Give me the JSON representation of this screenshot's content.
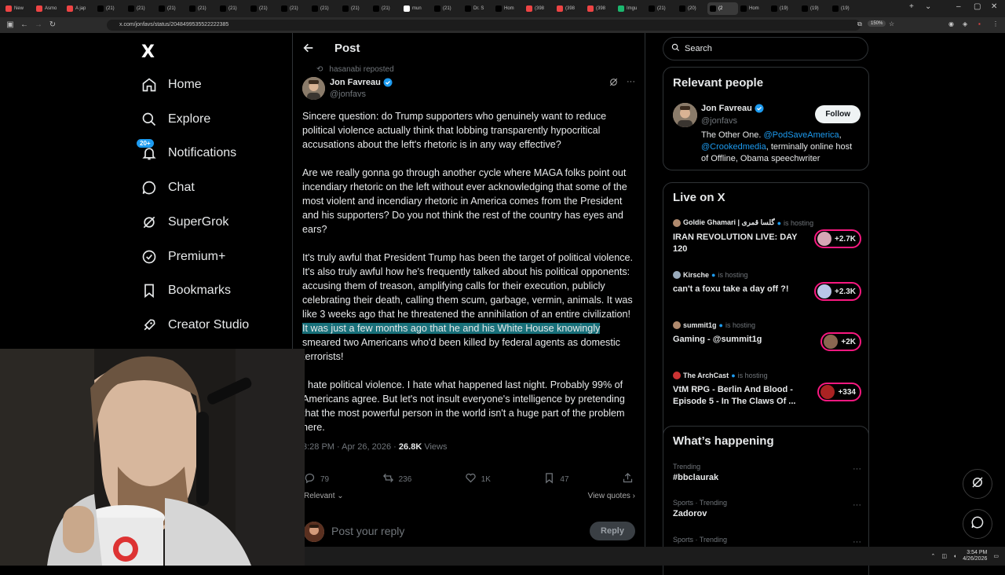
{
  "browser": {
    "tabs": [
      {
        "label": "New",
        "color": "#e44"
      },
      {
        "label": "Asmo",
        "color": "#e44"
      },
      {
        "label": "A jap",
        "color": "#e44"
      },
      {
        "label": "(21)",
        "color": "#000"
      },
      {
        "label": "(21)",
        "color": "#000"
      },
      {
        "label": "(21)",
        "color": "#000"
      },
      {
        "label": "(21)",
        "color": "#000"
      },
      {
        "label": "(21)",
        "color": "#000"
      },
      {
        "label": "(21)",
        "color": "#000"
      },
      {
        "label": "(21)",
        "color": "#000"
      },
      {
        "label": "(21)",
        "color": "#000"
      },
      {
        "label": "(21)",
        "color": "#000"
      },
      {
        "label": "(21)",
        "color": "#000"
      },
      {
        "label": "mun",
        "color": "#fff"
      },
      {
        "label": "(21)",
        "color": "#000"
      },
      {
        "label": "Dr. S",
        "color": "#000"
      },
      {
        "label": "Hom",
        "color": "#000"
      },
      {
        "label": "(398",
        "color": "#e44"
      },
      {
        "label": "(398",
        "color": "#e44"
      },
      {
        "label": "(398",
        "color": "#e44"
      },
      {
        "label": "Imgu",
        "color": "#1bb76e"
      },
      {
        "label": "(21)",
        "color": "#000"
      },
      {
        "label": "(20)",
        "color": "#000"
      },
      {
        "label": "(2",
        "color": "#000"
      },
      {
        "label": "Hom",
        "color": "#000"
      },
      {
        "label": "(19)",
        "color": "#000"
      },
      {
        "label": "(19)",
        "color": "#000"
      },
      {
        "label": "(19)",
        "color": "#000"
      }
    ],
    "url": "x.com/jonfavs/status/2048499535522222385",
    "zoom": "150%"
  },
  "sidebar": {
    "logo": "X",
    "notifications_badge": "20+",
    "items": [
      {
        "label": "Home",
        "icon": "home-icon"
      },
      {
        "label": "Explore",
        "icon": "search-icon"
      },
      {
        "label": "Notifications",
        "icon": "bell-icon"
      },
      {
        "label": "Chat",
        "icon": "chat-icon"
      },
      {
        "label": "SuperGrok",
        "icon": "grok-icon"
      },
      {
        "label": "Premium+",
        "icon": "premium-icon"
      },
      {
        "label": "Bookmarks",
        "icon": "bookmark-icon"
      },
      {
        "label": "Creator Studio",
        "icon": "rocket-icon"
      }
    ]
  },
  "post": {
    "header_title": "Post",
    "reposted_by": "hasanabi reposted",
    "author_name": "Jon Favreau",
    "author_handle": "@jonfavs",
    "p1": "Sincere question: do Trump supporters who genuinely want to reduce political violence actually think that lobbing transparently hypocritical accusations about the left's rhetoric is in any way effective?",
    "p2": "Are we really gonna go through another cycle where MAGA folks point out incendiary rhetoric on the left without ever acknowledging that some of the most violent and incendiary rhetoric in America comes from the President and his supporters? Do you not think the rest of the country has eyes and ears?",
    "p3_a": "It's truly awful that President Trump has been the target of political violence. It's also truly awful how he's frequently talked about his political opponents: accusing them of treason, amplifying calls for their execution, publicly celebrating their death, calling them scum, garbage, vermin, animals. It was like 3 weeks ago that he threatened the annihilation of an entire civilization! ",
    "p3_highlight": "It was just a few months ago that he and his White House knowingly",
    "p3_b": " smeared two Americans who'd been killed by federal agents as domestic terrorists!",
    "p4": "I hate political violence. I hate what happened last night. Probably 99% of Americans agree. But let's not insult everyone's intelligence by pretending that the most powerful person in the world isn't a huge part of the problem here.",
    "timestamp": "3:28 PM · Apr 26, 2026 · ",
    "views_count": "26.8K",
    "views_label": " Views",
    "replies": "79",
    "reposts": "236",
    "likes": "1K",
    "bookmarks": "47",
    "sort_label": "Relevant",
    "view_quotes": "View quotes",
    "reply_placeholder": "Post your reply",
    "reply_button": "Reply"
  },
  "right": {
    "search_placeholder": "Search",
    "relevant_people_title": "Relevant people",
    "person_name": "Jon Favreau",
    "person_handle": "@jonfavs",
    "follow_label": "Follow",
    "bio_a": "The Other One. ",
    "bio_link1": "@PodSaveAmerica",
    "bio_sep": ", ",
    "bio_link2": "@Crookedmedia",
    "bio_b": ", terminally online host of Offline, Obama speechwriter",
    "live_title": "Live on X",
    "live_items": [
      {
        "host": "Goldie Ghamari | گلسا قمری",
        "status": "is hosting",
        "title": "IRAN REVOLUTION LIVE: DAY 120",
        "count": "+2.7K"
      },
      {
        "host": "Kirsche",
        "status": "is hosting",
        "title": "can't a foxu take a day off ?!",
        "count": "+2.3K"
      },
      {
        "host": "summit1g",
        "status": "is hosting",
        "title": "Gaming - @summit1g",
        "count": "+2K"
      },
      {
        "host": "The ArchCast",
        "status": "is hosting",
        "title": "VtM RPG - Berlin And Blood - Episode 5 - In The Claws Of ...",
        "count": "+334"
      }
    ],
    "happening_title": "What’s happening",
    "trends": [
      {
        "category": "Trending",
        "name": "#bbclaurak"
      },
      {
        "category": "Sports · Trending",
        "name": "Zadorov"
      },
      {
        "category": "Sports · Trending",
        "name": ""
      }
    ]
  },
  "taskbar": {
    "time": "3:54 PM",
    "date": "4/26/2026"
  },
  "colors": {
    "accent": "#1d9bf0",
    "highlight": "#18707a",
    "live": "#f91880"
  }
}
